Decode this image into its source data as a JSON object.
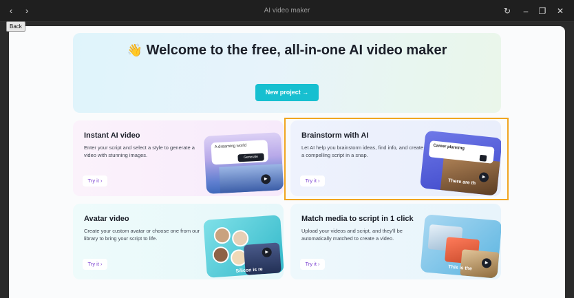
{
  "window": {
    "title": "AI video maker",
    "back_icon": "‹",
    "forward_icon": "›",
    "refresh_icon": "↻",
    "minimize_icon": "–",
    "restore_icon": "❐",
    "close_icon": "✕"
  },
  "tooltip": {
    "back": "Back"
  },
  "hero": {
    "wave": "👋",
    "title": "Welcome to the free, all-in-one AI video maker",
    "new_project": "New project →"
  },
  "cards": [
    {
      "title": "Instant AI video",
      "desc": "Enter your script and select a style to generate a video with stunning images.",
      "try": "Try it ›",
      "illus_prompt": "A dreaming world",
      "illus_button": "Generate"
    },
    {
      "title": "Brainstorm with AI",
      "desc": "Let AI help you brainstorm ideas, find info, and create a compelling script in a snap.",
      "try": "Try it ›",
      "illus_prompt": "Career planning",
      "illus_caption": "There are th"
    },
    {
      "title": "Avatar video",
      "desc": "Create your custom avatar or choose one from our library to bring your script to life.",
      "try": "Try it ›",
      "illus_caption": "Silicon is re"
    },
    {
      "title": "Match media to script in 1 click",
      "desc": "Upload your videos and script, and they'll be automatically matched to create a video.",
      "try": "Try it ›",
      "illus_caption": "This is the"
    }
  ],
  "colors": {
    "accent": "#17bfd0",
    "highlight": "#f0a520",
    "try_text": "#7a3fd0"
  }
}
